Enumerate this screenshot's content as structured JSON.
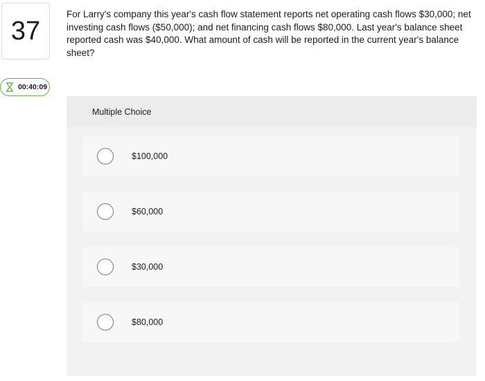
{
  "question_number": "37",
  "timer": "00:40:09",
  "question_text": "For Larry's company this year's cash flow statement reports net operating cash flows $30,000; net investing cash flows ($50,000); and net financing cash flows $80,000. Last year's balance sheet reported cash was $40,000. What amount of cash will be reported in the current year's balance sheet?",
  "choices_header": "Multiple Choice",
  "options": [
    {
      "label": "$100,000"
    },
    {
      "label": "$60,000"
    },
    {
      "label": "$30,000"
    },
    {
      "label": "$80,000"
    }
  ],
  "icons": {
    "timer": "hourglass-icon"
  },
  "colors": {
    "timer_border": "#6ab04c",
    "radio_border": "#6e7b8a"
  }
}
